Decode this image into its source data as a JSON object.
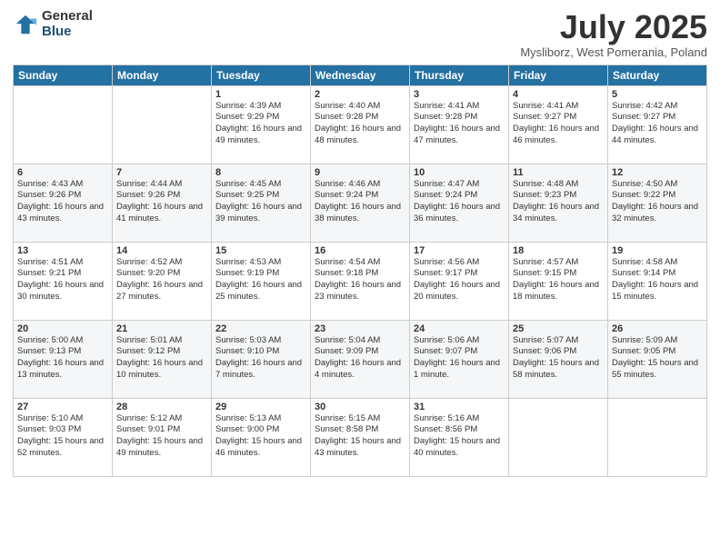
{
  "logo": {
    "general": "General",
    "blue": "Blue"
  },
  "title": "July 2025",
  "subtitle": "Mysliborz, West Pomerania, Poland",
  "weekdays": [
    "Sunday",
    "Monday",
    "Tuesday",
    "Wednesday",
    "Thursday",
    "Friday",
    "Saturday"
  ],
  "weeks": [
    [
      {
        "day": "",
        "sunrise": "",
        "sunset": "",
        "daylight": ""
      },
      {
        "day": "",
        "sunrise": "",
        "sunset": "",
        "daylight": ""
      },
      {
        "day": "1",
        "sunrise": "Sunrise: 4:39 AM",
        "sunset": "Sunset: 9:29 PM",
        "daylight": "Daylight: 16 hours and 49 minutes."
      },
      {
        "day": "2",
        "sunrise": "Sunrise: 4:40 AM",
        "sunset": "Sunset: 9:28 PM",
        "daylight": "Daylight: 16 hours and 48 minutes."
      },
      {
        "day": "3",
        "sunrise": "Sunrise: 4:41 AM",
        "sunset": "Sunset: 9:28 PM",
        "daylight": "Daylight: 16 hours and 47 minutes."
      },
      {
        "day": "4",
        "sunrise": "Sunrise: 4:41 AM",
        "sunset": "Sunset: 9:27 PM",
        "daylight": "Daylight: 16 hours and 46 minutes."
      },
      {
        "day": "5",
        "sunrise": "Sunrise: 4:42 AM",
        "sunset": "Sunset: 9:27 PM",
        "daylight": "Daylight: 16 hours and 44 minutes."
      }
    ],
    [
      {
        "day": "6",
        "sunrise": "Sunrise: 4:43 AM",
        "sunset": "Sunset: 9:26 PM",
        "daylight": "Daylight: 16 hours and 43 minutes."
      },
      {
        "day": "7",
        "sunrise": "Sunrise: 4:44 AM",
        "sunset": "Sunset: 9:26 PM",
        "daylight": "Daylight: 16 hours and 41 minutes."
      },
      {
        "day": "8",
        "sunrise": "Sunrise: 4:45 AM",
        "sunset": "Sunset: 9:25 PM",
        "daylight": "Daylight: 16 hours and 39 minutes."
      },
      {
        "day": "9",
        "sunrise": "Sunrise: 4:46 AM",
        "sunset": "Sunset: 9:24 PM",
        "daylight": "Daylight: 16 hours and 38 minutes."
      },
      {
        "day": "10",
        "sunrise": "Sunrise: 4:47 AM",
        "sunset": "Sunset: 9:24 PM",
        "daylight": "Daylight: 16 hours and 36 minutes."
      },
      {
        "day": "11",
        "sunrise": "Sunrise: 4:48 AM",
        "sunset": "Sunset: 9:23 PM",
        "daylight": "Daylight: 16 hours and 34 minutes."
      },
      {
        "day": "12",
        "sunrise": "Sunrise: 4:50 AM",
        "sunset": "Sunset: 9:22 PM",
        "daylight": "Daylight: 16 hours and 32 minutes."
      }
    ],
    [
      {
        "day": "13",
        "sunrise": "Sunrise: 4:51 AM",
        "sunset": "Sunset: 9:21 PM",
        "daylight": "Daylight: 16 hours and 30 minutes."
      },
      {
        "day": "14",
        "sunrise": "Sunrise: 4:52 AM",
        "sunset": "Sunset: 9:20 PM",
        "daylight": "Daylight: 16 hours and 27 minutes."
      },
      {
        "day": "15",
        "sunrise": "Sunrise: 4:53 AM",
        "sunset": "Sunset: 9:19 PM",
        "daylight": "Daylight: 16 hours and 25 minutes."
      },
      {
        "day": "16",
        "sunrise": "Sunrise: 4:54 AM",
        "sunset": "Sunset: 9:18 PM",
        "daylight": "Daylight: 16 hours and 23 minutes."
      },
      {
        "day": "17",
        "sunrise": "Sunrise: 4:56 AM",
        "sunset": "Sunset: 9:17 PM",
        "daylight": "Daylight: 16 hours and 20 minutes."
      },
      {
        "day": "18",
        "sunrise": "Sunrise: 4:57 AM",
        "sunset": "Sunset: 9:15 PM",
        "daylight": "Daylight: 16 hours and 18 minutes."
      },
      {
        "day": "19",
        "sunrise": "Sunrise: 4:58 AM",
        "sunset": "Sunset: 9:14 PM",
        "daylight": "Daylight: 16 hours and 15 minutes."
      }
    ],
    [
      {
        "day": "20",
        "sunrise": "Sunrise: 5:00 AM",
        "sunset": "Sunset: 9:13 PM",
        "daylight": "Daylight: 16 hours and 13 minutes."
      },
      {
        "day": "21",
        "sunrise": "Sunrise: 5:01 AM",
        "sunset": "Sunset: 9:12 PM",
        "daylight": "Daylight: 16 hours and 10 minutes."
      },
      {
        "day": "22",
        "sunrise": "Sunrise: 5:03 AM",
        "sunset": "Sunset: 9:10 PM",
        "daylight": "Daylight: 16 hours and 7 minutes."
      },
      {
        "day": "23",
        "sunrise": "Sunrise: 5:04 AM",
        "sunset": "Sunset: 9:09 PM",
        "daylight": "Daylight: 16 hours and 4 minutes."
      },
      {
        "day": "24",
        "sunrise": "Sunrise: 5:06 AM",
        "sunset": "Sunset: 9:07 PM",
        "daylight": "Daylight: 16 hours and 1 minute."
      },
      {
        "day": "25",
        "sunrise": "Sunrise: 5:07 AM",
        "sunset": "Sunset: 9:06 PM",
        "daylight": "Daylight: 15 hours and 58 minutes."
      },
      {
        "day": "26",
        "sunrise": "Sunrise: 5:09 AM",
        "sunset": "Sunset: 9:05 PM",
        "daylight": "Daylight: 15 hours and 55 minutes."
      }
    ],
    [
      {
        "day": "27",
        "sunrise": "Sunrise: 5:10 AM",
        "sunset": "Sunset: 9:03 PM",
        "daylight": "Daylight: 15 hours and 52 minutes."
      },
      {
        "day": "28",
        "sunrise": "Sunrise: 5:12 AM",
        "sunset": "Sunset: 9:01 PM",
        "daylight": "Daylight: 15 hours and 49 minutes."
      },
      {
        "day": "29",
        "sunrise": "Sunrise: 5:13 AM",
        "sunset": "Sunset: 9:00 PM",
        "daylight": "Daylight: 15 hours and 46 minutes."
      },
      {
        "day": "30",
        "sunrise": "Sunrise: 5:15 AM",
        "sunset": "Sunset: 8:58 PM",
        "daylight": "Daylight: 15 hours and 43 minutes."
      },
      {
        "day": "31",
        "sunrise": "Sunrise: 5:16 AM",
        "sunset": "Sunset: 8:56 PM",
        "daylight": "Daylight: 15 hours and 40 minutes."
      },
      {
        "day": "",
        "sunrise": "",
        "sunset": "",
        "daylight": ""
      },
      {
        "day": "",
        "sunrise": "",
        "sunset": "",
        "daylight": ""
      }
    ]
  ]
}
